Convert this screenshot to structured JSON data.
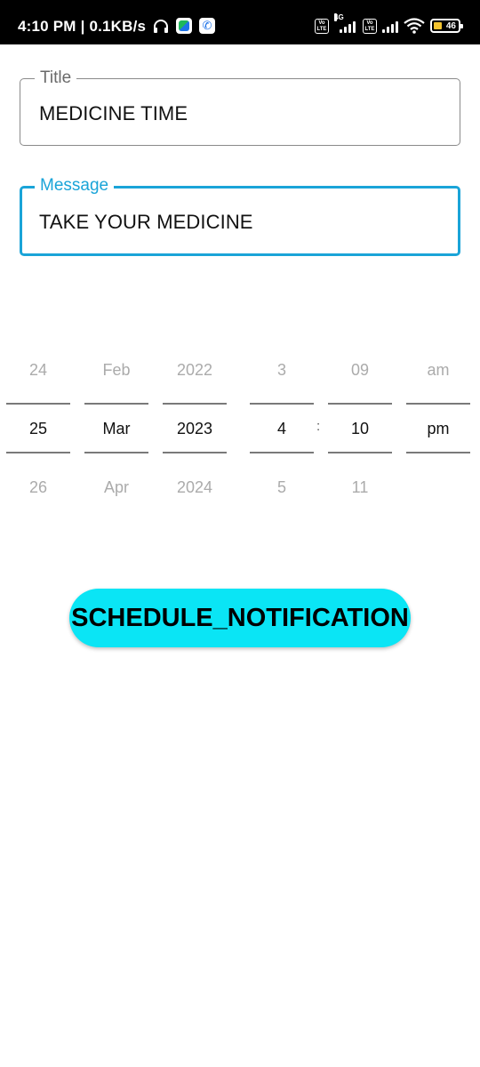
{
  "status_bar": {
    "time_speed": "4:10 PM | 0.1KB/s",
    "volte_1": "Vo LTE",
    "net_1": "4G",
    "volte_2": "Vo LTE",
    "battery": "46",
    "icons": [
      "headphones-icon",
      "chat-app-icon",
      "phone-app-icon",
      "volte-icon",
      "signal-icon",
      "wifi-icon",
      "battery-icon"
    ]
  },
  "form": {
    "title_label": "Title",
    "title_value": "MEDICINE TIME",
    "message_label": "Message",
    "message_value": "TAKE YOUR MEDICINE",
    "focused_field": "message",
    "accent_color": "#1aa4d8"
  },
  "picker": {
    "day": {
      "prev": "24",
      "current": "25",
      "next": "26"
    },
    "month": {
      "prev": "Feb",
      "current": "Mar",
      "next": "Apr"
    },
    "year": {
      "prev": "2022",
      "current": "2023",
      "next": "2024"
    },
    "hour": {
      "prev": "3",
      "current": "4",
      "next": "5"
    },
    "separator": ":",
    "minute": {
      "prev": "09",
      "current": "10",
      "next": "11"
    },
    "ampm": {
      "prev": "am",
      "current": "pm",
      "next": ""
    }
  },
  "actions": {
    "schedule_label": "SCHEDULE_NOTIFICATION",
    "schedule_color": "#0ae5f5"
  }
}
